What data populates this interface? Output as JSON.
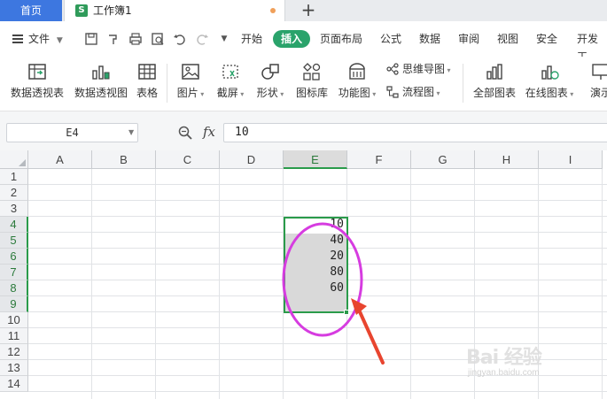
{
  "tabs": {
    "home_label": "首页",
    "doc_icon": "S",
    "doc_title": "工作簿1",
    "new_tab": "+"
  },
  "menubar": {
    "file_label": "文件",
    "tabs": [
      "开始",
      "插入",
      "页面布局",
      "公式",
      "数据",
      "审阅",
      "视图",
      "安全",
      "开发工"
    ],
    "active_tab": "插入"
  },
  "ribbon": {
    "buttons": [
      {
        "label": "数据透视表",
        "icon": "pivot-table-icon"
      },
      {
        "label": "数据透视图",
        "icon": "pivot-chart-icon"
      },
      {
        "label": "表格",
        "icon": "table-icon"
      },
      {
        "label": "图片",
        "icon": "picture-icon"
      },
      {
        "label": "截屏",
        "icon": "screenshot-icon"
      },
      {
        "label": "形状",
        "icon": "shapes-icon"
      },
      {
        "label": "图标库",
        "icon": "icon-library-icon"
      },
      {
        "label": "功能图",
        "icon": "function-chart-icon"
      },
      {
        "label": "全部图表",
        "icon": "all-charts-icon"
      },
      {
        "label": "在线图表",
        "icon": "online-charts-icon"
      },
      {
        "label": "演示",
        "icon": "presentation-icon"
      }
    ],
    "small_buttons": [
      {
        "label": "思维导图",
        "icon": "mindmap-icon"
      },
      {
        "label": "流程图",
        "icon": "flowchart-icon"
      }
    ]
  },
  "formula_bar": {
    "cell_ref": "E4",
    "fx_label": "fx",
    "formula_value": "10"
  },
  "grid": {
    "columns": [
      "A",
      "B",
      "C",
      "D",
      "E",
      "F",
      "G",
      "H",
      "I"
    ],
    "rows": [
      "1",
      "2",
      "3",
      "4",
      "5",
      "6",
      "7",
      "8",
      "9",
      "10",
      "11",
      "12",
      "13",
      "14"
    ],
    "selected_column": "E",
    "selected_rows": [
      "4",
      "5",
      "6",
      "7",
      "8",
      "9"
    ],
    "cells_E": [
      {
        "row": "4",
        "value": "10"
      },
      {
        "row": "5",
        "value": "40"
      },
      {
        "row": "6",
        "value": "20"
      },
      {
        "row": "7",
        "value": "80"
      },
      {
        "row": "8",
        "value": "60"
      }
    ]
  },
  "annotation": {
    "ellipse_color": "#d63ce0",
    "arrow_color": "#e8452f"
  },
  "watermark": {
    "text": "Bai 经验",
    "sub": "jingyan.baidu.com"
  },
  "colors": {
    "accent_green": "#2aa36b",
    "selection_green": "#2a9b4a",
    "home_tab_blue": "#3d77e0"
  }
}
